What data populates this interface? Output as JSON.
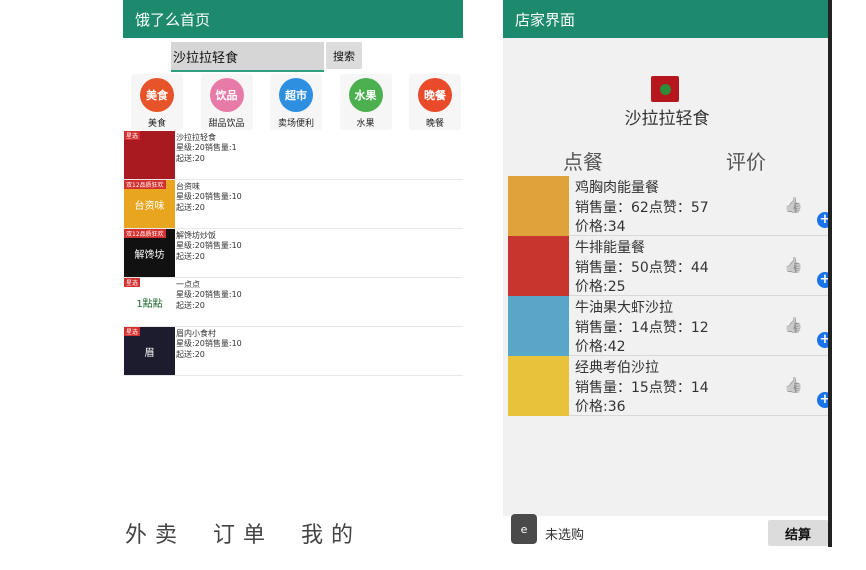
{
  "colors": {
    "appbar": "#1d8a6e",
    "search_underline": "#2ea07f",
    "add_button": "#1a73e8",
    "shop_tag": "#d32f2f"
  },
  "home": {
    "title": "饿了么首页",
    "search": {
      "value": "沙拉拉轻食",
      "button": "搜索"
    },
    "categories": [
      {
        "icon_text": "美食",
        "label": "美食",
        "color": "#e8542a"
      },
      {
        "icon_text": "饮品",
        "label": "甜品饮品",
        "color": "#e87aa8"
      },
      {
        "icon_text": "超市",
        "label": "卖场便利",
        "color": "#2e8fe0"
      },
      {
        "icon_text": "水果",
        "label": "水果",
        "color": "#4caf50"
      },
      {
        "icon_text": "晚餐",
        "label": "晚餐",
        "color": "#e84a2a"
      }
    ],
    "shops": [
      {
        "name": "沙拉拉轻食",
        "stats": "星级:20销售量:1",
        "min": "起送:20",
        "tag": "星选",
        "img_text": "",
        "img_color": "#a81a20"
      },
      {
        "name": "台资味",
        "stats": "星级:20销售量:10",
        "min": "起送:20",
        "tag": "双12品质狂欢",
        "img_text": "台资味",
        "img_color": "#e8a620"
      },
      {
        "name": "解馋坊炒饭",
        "stats": "星级:20销售量:10",
        "min": "起送:20",
        "tag": "双12品质狂欢",
        "img_text": "解馋坊",
        "img_color": "#111111"
      },
      {
        "name": "一点点",
        "stats": "星级:20销售量:10",
        "min": "起送:20",
        "tag": "星选",
        "img_text": "1點點",
        "img_color": "#ffffff"
      },
      {
        "name": "眉内小食村",
        "stats": "星级:20销售量:10",
        "min": "起送:20",
        "tag": "星选",
        "img_text": "眉",
        "img_color": "#1c1c2e"
      }
    ],
    "nav": [
      "外卖",
      "订单",
      "我的"
    ]
  },
  "store": {
    "title": "店家界面",
    "name": "沙拉拉轻食",
    "tabs": [
      "点餐",
      "评价"
    ],
    "like_icon": "thumbs-up-icon",
    "dishes": [
      {
        "name": "鸡胸肉能量餐",
        "stats": "销售量：62点赞：57",
        "price": "价格:34",
        "img_color": "#e0a23a"
      },
      {
        "name": "牛排能量餐",
        "stats": "销售量：50点赞：44",
        "price": "价格:25",
        "img_color": "#c8342e"
      },
      {
        "name": "牛油果大虾沙拉",
        "stats": "销售量：14点赞：12",
        "price": "价格:42",
        "img_color": "#5aa6c8"
      },
      {
        "name": "经典考伯沙拉",
        "stats": "销售量：15点赞：14",
        "price": "价格:36",
        "img_color": "#e8c23a"
      }
    ],
    "cart": {
      "status": "未选购",
      "checkout": "结算"
    }
  }
}
